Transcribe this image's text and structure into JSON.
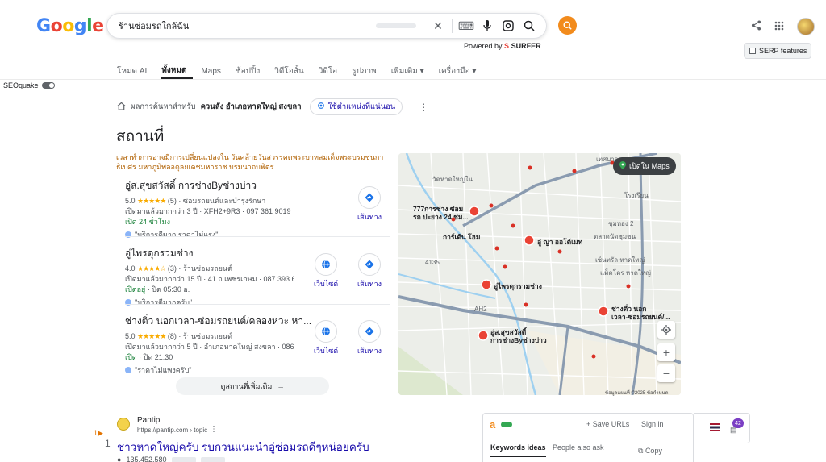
{
  "search": {
    "query": "ร้านซ่อมรถใกล้ฉัน",
    "powered_prefix": "Powered by",
    "powered_brand": "SURFER"
  },
  "logo": [
    "G",
    "o",
    "o",
    "g",
    "l",
    "e"
  ],
  "logo_colors": [
    "#4285f4",
    "#ea4335",
    "#fbbc05",
    "#4285f4",
    "#34a853",
    "#ea4335"
  ],
  "serp_features_label": "SERP features",
  "seoquake_label": "SEOquake",
  "tabs": [
    {
      "label": "โหมด AI",
      "active": false
    },
    {
      "label": "ทั้งหมด",
      "active": true
    },
    {
      "label": "Maps",
      "active": false
    },
    {
      "label": "ช้อปปิ้ง",
      "active": false
    },
    {
      "label": "วิดีโอสั้น",
      "active": false
    },
    {
      "label": "วิดีโอ",
      "active": false
    },
    {
      "label": "รูปภาพ",
      "active": false
    },
    {
      "label": "เพิ่มเติม ▾",
      "active": false
    },
    {
      "label": "เครื่องมือ ▾",
      "active": false
    }
  ],
  "location": {
    "prefix": "ผลการค้นหาสำหรับ",
    "place": "ควนลัง อำเภอหาดใหญ่ สงขลา",
    "precise_btn": "ใช้ตำแหน่งที่แน่นอน"
  },
  "places": {
    "title": "สถานที่",
    "notice": "เวลาทำการอาจมีการเปลี่ยนแปลงใน วันคล้ายวันสวรรคตพระบาทสมเด็จพระบรมชนกาธิเบศร มหาภูมิพลอดุลยเดชมหาราช บรมนาถบพิตร",
    "items": [
      {
        "name": "อู่ส.สุขสวัสดิ์ การช่างByช่างบ่าว",
        "rating": "5.0",
        "stars": "★★★★★",
        "count": "(5)",
        "category": "ซ่อมรถยนต์และบำรุงรักษา",
        "line2": "เปิดมาแล้วมากกว่า 3 ปี · XFH2+9R3 · 097 361 9019",
        "hours_open": "เปิด 24 ชั่วโมง",
        "hours_rest": "",
        "review": "\"บริการดีมาก ราคาไม่แรง\""
      },
      {
        "name": "อู่ไพรดุกรวมช่าง",
        "rating": "4.0",
        "stars": "★★★★☆",
        "count": "(3)",
        "category": "ร้านซ่อมรถยนต์",
        "line2": "เปิดมาแล้วมากกว่า 15 ปี · 41 ถ.เพชรเกษม · 087 393 6...",
        "hours_open": "เปิดอยู่",
        "hours_rest": " · ปิด 05:30 อ.",
        "review": "\"บริการดีมากครับ\""
      },
      {
        "name": "ช่างติ่ว นอกเวลา-ซ่อมรถยนต์/คลองหวะ หา...",
        "rating": "5.0",
        "stars": "★★★★★",
        "count": "(8)",
        "category": "ร้านซ่อมรถยนต์",
        "line2": "เปิดมาแล้วมากกว่า 5 ปี · อำเภอหาดใหญ่ สงขลา · 086 ...",
        "hours_open": "เปิด",
        "hours_rest": " · ปิด 21:30",
        "review": "\"ราคาไม่แพงครับ\""
      }
    ],
    "website_label": "เว็บไซต์",
    "directions_label": "เส้นทาง",
    "more_label": "ดูสถานที่เพิ่มเติม"
  },
  "map": {
    "open_label": "เปิดใน Maps",
    "footer": "ข้อมูลแผนที่ ©2025   ข้อกำหนด",
    "labels": {
      "l1": "777การช่าง ซ่อม",
      "l2": "รถ ปะยาง 24 ชม...",
      "l3": "การ์เต้น โฮม",
      "l4": "อู่ ญา ออโต้เมท",
      "l5": "อู่ไพรดุกรวมช่าง",
      "l6": "อู่ส.สุขสวัสดิ์",
      "l7": "การช่างByช่างบ่าว",
      "l8": "ช่างติ่ว นอก",
      "l9": "เวลา-ซ่อมรถยนต์/...",
      "l10": "เทศบาลนคร",
      "l11": "โรงเรียน",
      "l12": "ขุมทอง 2",
      "l13": "เซ็นทรัล หาดใหญ่",
      "l14": "แม็คโคร หาดใหญ่",
      "l15": "วัดหาดใหญ่ใน",
      "l16": "ตลาดนัดชุมชน",
      "l17": "AH2",
      "l18": "4135"
    }
  },
  "result": {
    "number": "1",
    "number_marker": "1▶",
    "site": "Pantip",
    "url": "https://pantip.com › topic",
    "title": "ชาวหาดใหญ่ครับ รบกวนแนะนำอู่ซ่อมรถดีๆหน่อยครับ",
    "meta": "135,452,580"
  },
  "kw_panel": {
    "save": "+ Save URLs",
    "sign_in": "Sign in",
    "tab1": "Keywords ideas",
    "tab2": "People also ask",
    "copy": "Copy",
    "badge": "42"
  }
}
